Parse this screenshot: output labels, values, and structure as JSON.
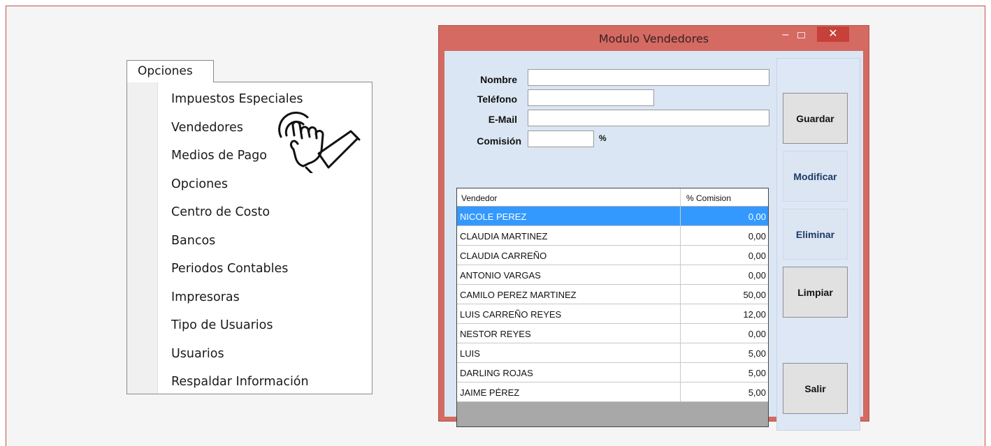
{
  "menu": {
    "tab_label": "Opciones",
    "items": [
      {
        "label": "Impuestos Especiales"
      },
      {
        "label": "Vendedores"
      },
      {
        "label": "Medios de Pago"
      },
      {
        "label": "Opciones"
      },
      {
        "label": "Centro de Costo"
      },
      {
        "label": "Bancos"
      },
      {
        "label": "Periodos Contables"
      },
      {
        "label": "Impresoras"
      },
      {
        "label": "Tipo de Usuarios"
      },
      {
        "label": "Usuarios"
      },
      {
        "label": "Respaldar Información"
      }
    ],
    "pointer_icon": "hand-tap-icon"
  },
  "window": {
    "title": "Modulo Vendedores",
    "controls": {
      "minimize": "–",
      "close": "✕"
    },
    "accent": "#d46a62",
    "client_bg": "#dbe6f4"
  },
  "form": {
    "nombre_label": "Nombre",
    "nombre_value": "",
    "telefono_label": "Teléfono",
    "telefono_value": "",
    "email_label": "E-Mail",
    "email_value": "",
    "comision_label": "Comisión",
    "comision_value": "",
    "percent_sign": "%"
  },
  "grid": {
    "columns": [
      "Vendedor",
      "% Comision"
    ],
    "selected_index": 0,
    "selected_color": "#3399ff",
    "rows": [
      {
        "vendedor": "NICOLE PEREZ",
        "comision": "0,00"
      },
      {
        "vendedor": "CLAUDIA MARTINEZ",
        "comision": "0,00"
      },
      {
        "vendedor": "CLAUDIA CARREÑO",
        "comision": "0,00"
      },
      {
        "vendedor": "ANTONIO VARGAS",
        "comision": "0,00"
      },
      {
        "vendedor": "CAMILO PEREZ MARTINEZ",
        "comision": "50,00"
      },
      {
        "vendedor": "LUIS CARREÑO REYES",
        "comision": "12,00"
      },
      {
        "vendedor": "NESTOR REYES",
        "comision": "0,00"
      },
      {
        "vendedor": "LUIS",
        "comision": "5,00"
      },
      {
        "vendedor": "DARLING ROJAS",
        "comision": "5,00"
      },
      {
        "vendedor": "JAIME PÉREZ",
        "comision": "5,00"
      }
    ]
  },
  "buttons": {
    "guardar": "Guardar",
    "modificar": "Modificar",
    "eliminar": "Eliminar",
    "limpiar": "Limpiar",
    "salir": "Salir"
  }
}
